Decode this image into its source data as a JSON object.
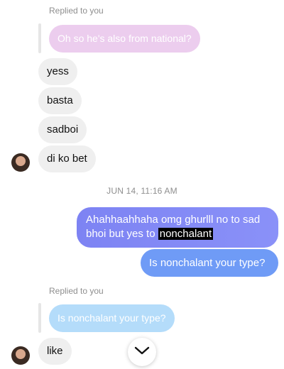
{
  "first_reply": {
    "label": "Replied to you",
    "quoted_text": "Oh so he's also from national?"
  },
  "incoming_group_1": [
    "yess",
    "basta",
    "sadboi",
    "di ko bet"
  ],
  "timestamp": "JUN 14, 11:16 AM",
  "outgoing": {
    "message_1_prefix": "Ahahhaahhaha omg ghurlll no to sad bhoi but yes to ",
    "message_1_highlight": "nonchalant",
    "message_2": "Is nonchalant your type?"
  },
  "second_reply": {
    "label": "Replied to you",
    "quoted_text": "Is nonchalant your type?"
  },
  "incoming_group_2": [
    "like"
  ],
  "icons": {
    "scroll": "chevron-down-icon",
    "avatar": "avatar"
  },
  "colors": {
    "incoming_bubble": "#efefef",
    "outgoing_purple": "#8a91f8",
    "outgoing_blue": "#6f9bf6",
    "quoted_pink": "#eccdee",
    "quoted_blue": "#b4dcfa"
  }
}
